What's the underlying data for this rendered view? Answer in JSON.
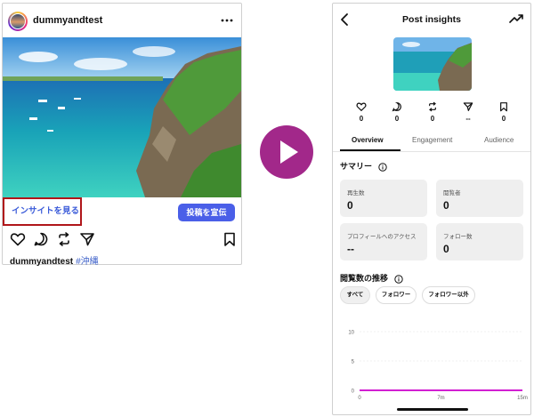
{
  "post": {
    "username": "dummyandtest",
    "insights_link": "インサイトを見る",
    "promote_button": "投稿を宣伝",
    "caption_user": "dummyandtest",
    "caption_tag": "#沖縄"
  },
  "insights": {
    "title": "Post insights",
    "stats": [
      {
        "icon": "heart-icon",
        "value": "0"
      },
      {
        "icon": "comment-icon",
        "value": "0"
      },
      {
        "icon": "repost-icon",
        "value": "0"
      },
      {
        "icon": "share-icon",
        "value": "--"
      },
      {
        "icon": "bookmark-icon",
        "value": "0"
      }
    ],
    "tabs": [
      "Overview",
      "Engagement",
      "Audience"
    ],
    "summary_title": "サマリー",
    "metrics": [
      {
        "label": "再生数",
        "value": "0"
      },
      {
        "label": "閲覧者",
        "value": "0"
      },
      {
        "label": "プロフィールへのアクセス",
        "value": "--"
      },
      {
        "label": "フォロー数",
        "value": "0"
      }
    ],
    "views_title": "閲覧数の推移",
    "filters": [
      "すべて",
      "フォロワー",
      "フォロワー以外"
    ]
  },
  "chart_data": {
    "type": "line",
    "x_ticks": [
      "0",
      "7m",
      "15m"
    ],
    "y_ticks": [
      "10",
      "5",
      "0"
    ],
    "ylim": [
      0,
      10
    ],
    "series": [
      {
        "color": "#d21fd2",
        "x": [
          "0",
          "15m"
        ],
        "values": [
          0,
          0
        ]
      }
    ]
  },
  "colors": {
    "accent_blue": "#4a5fe8",
    "highlight_red": "#b0161a",
    "play_purple": "#a2288a",
    "series_magenta": "#d21fd2"
  }
}
